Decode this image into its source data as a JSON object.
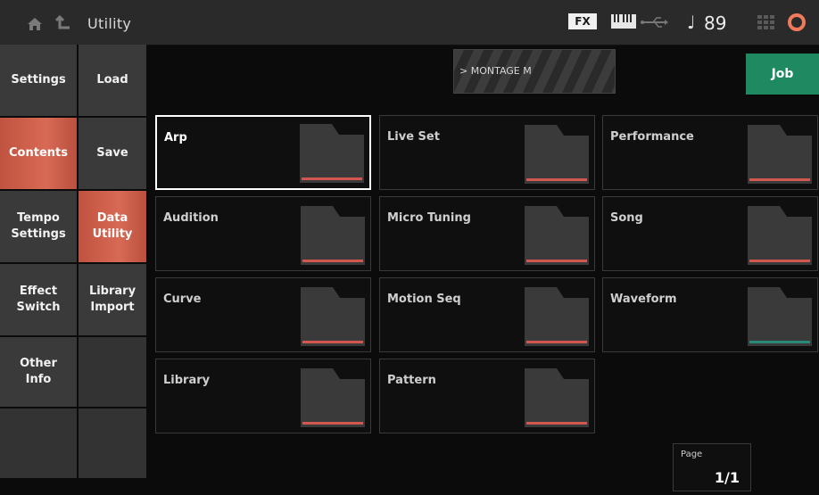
{
  "header": {
    "title": "Utility",
    "fx_badge": "FX",
    "tempo": "89",
    "icons": [
      "home-icon",
      "back-icon",
      "keyboard-icon",
      "usb-icon",
      "note-icon",
      "grid-icon",
      "gear-icon"
    ]
  },
  "left_tabs": [
    {
      "label": "Settings",
      "active": false
    },
    {
      "label": "Contents",
      "active": true
    },
    {
      "label": "Tempo Settings",
      "active": false
    },
    {
      "label": "Effect Switch",
      "active": false
    },
    {
      "label": "Other Info",
      "active": false
    }
  ],
  "sub_tabs": [
    {
      "label": "Load",
      "active": false
    },
    {
      "label": "Save",
      "active": false
    },
    {
      "label": "Data Utility",
      "active": true
    },
    {
      "label": "Library Import",
      "active": false
    }
  ],
  "banner": {
    "text": "> MONTAGE M"
  },
  "job_label": "Job",
  "folders": [
    {
      "label": "Arp",
      "selected": true
    },
    {
      "label": "Live Set",
      "selected": false
    },
    {
      "label": "Performance",
      "selected": false
    },
    {
      "label": "Audition",
      "selected": false
    },
    {
      "label": "Micro Tuning",
      "selected": false
    },
    {
      "label": "Song",
      "selected": false
    },
    {
      "label": "Curve",
      "selected": false
    },
    {
      "label": "Motion Seq",
      "selected": false
    },
    {
      "label": "Waveform",
      "selected": false
    },
    {
      "label": "Library",
      "selected": false
    },
    {
      "label": "Pattern",
      "selected": false
    }
  ],
  "page": {
    "label": "Page",
    "value": "1/1"
  },
  "colors": {
    "accent": "#c0533f",
    "job": "#1f8a62",
    "folder_stripe": "#d2574f",
    "gear": "#f07a5a"
  }
}
